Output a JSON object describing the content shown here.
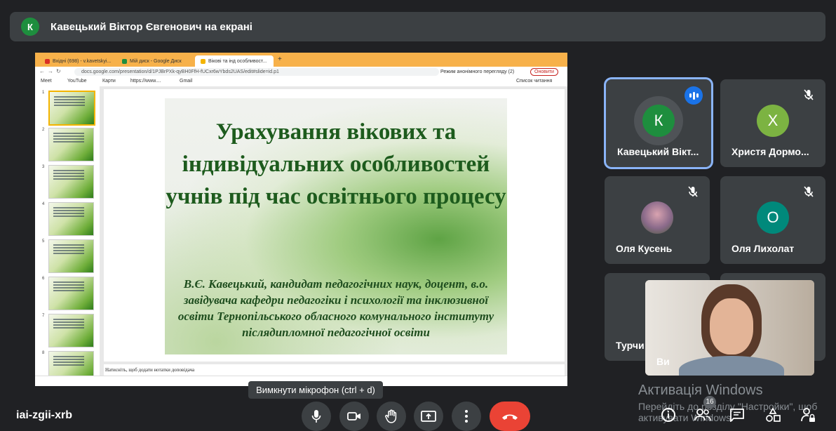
{
  "top_bar": {
    "avatar_letter": "К",
    "title": "Кавецький Віктор Євгенович на екрані"
  },
  "shared_screen": {
    "tabs": [
      {
        "label": "Вхідні (698) - v.kavetskyi..."
      },
      {
        "label": "Мій диск - Google Диск"
      },
      {
        "label": "Вікові та інд особливост..."
      }
    ],
    "new_tab": "+",
    "url": "docs.google.com/presentation/d/1PJBrPXk-qyBH0FfH-fUCxr6wYbds2UAS/edit#slide=id.p1",
    "incognito": "Режим анонімного перегляду (2)",
    "update_button": "Оновити",
    "bookmarks": [
      "Meet",
      "YouTube",
      "Карти",
      "https://www....",
      "Gmail"
    ],
    "reading_list": "Список читання",
    "slide_numbers": [
      "1",
      "2",
      "3",
      "4",
      "5",
      "6",
      "7",
      "8"
    ],
    "slide": {
      "title": "Урахування вікових та індивідуальних особливостей учнів під час освітнього процесу",
      "author": "В.Є. Кавецький, кандидат педагогічних наук, доцент, в.о. завідувача кафедри педагогіки і психології та інклюзивної освіти Тернопільського обласного комунального інституту післядипломної педагогічної освіти"
    },
    "notes_placeholder": "Натисніть, щоб додати нотатки доповідача"
  },
  "tooltip": "Вимкнути мікрофон (ctrl + d)",
  "participants": [
    {
      "name": "Кавецький Вікт...",
      "letter": "К",
      "color": "#1e8e3e",
      "speaking": true
    },
    {
      "name": "Христя Дормо...",
      "letter": "Х",
      "color": "#7cb342",
      "muted": true
    },
    {
      "name": "Оля Кусень",
      "letter": "",
      "color": "#8a6a8a",
      "muted": true
    },
    {
      "name": "Оля Лихолат",
      "letter": "О",
      "color": "#00897b",
      "muted": true
    },
    {
      "name": "Турчи",
      "letter": "",
      "color": "#5f6368"
    }
  ],
  "self_view_label": "Ви",
  "meeting_code": "iai-zgii-xrb",
  "participants_count": "16",
  "windows_watermark": {
    "line1": "Активація Windows",
    "line2": "Перейдіть до розділу \"Настройки\", щоб",
    "line3": "активувати Windows."
  }
}
